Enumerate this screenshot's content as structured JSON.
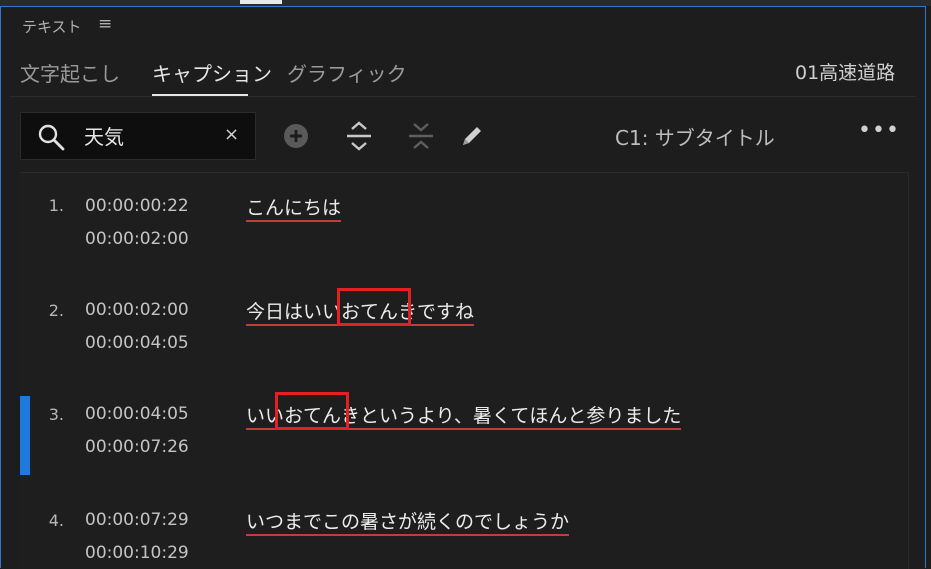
{
  "panel": {
    "title": "テキスト"
  },
  "tabs": [
    {
      "label": "文字起こし"
    },
    {
      "label": "キャプション"
    },
    {
      "label": "グラフィック"
    }
  ],
  "sequence_name": "01高速道路",
  "search": {
    "value": "天気",
    "clear_symbol": "×"
  },
  "caption_track": "C1: サブタイトル",
  "more_symbol": "•••",
  "captions": [
    {
      "number": "1.",
      "start": "00:00:00:22",
      "end": "00:00:02:00",
      "text": "こんにちは"
    },
    {
      "number": "2.",
      "start": "00:00:02:00",
      "end": "00:00:04:05",
      "text_parts": [
        "今日はいい",
        "おてんき",
        "ですね"
      ]
    },
    {
      "number": "3.",
      "start": "00:00:04:05",
      "end": "00:00:07:26",
      "text_parts": [
        "いい",
        "おてんき",
        "というより、暑くてほんと参りました"
      ]
    },
    {
      "number": "4.",
      "start": "00:00:07:29",
      "end": "00:00:10:29",
      "text": "いつまでこの暑さが続くのでしょうか"
    }
  ],
  "colors": {
    "accent": "#1f7ae0",
    "highlight_box": "#e32121",
    "underline": "#c43b3b",
    "frame": "#2d78c8"
  }
}
